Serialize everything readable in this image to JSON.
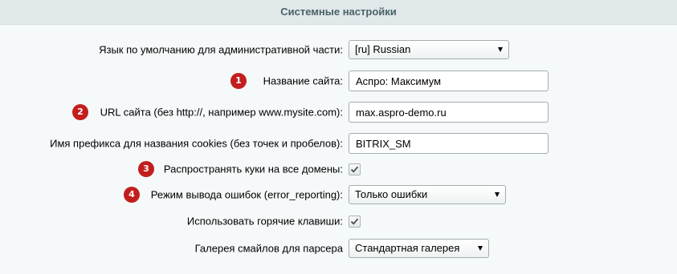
{
  "header": {
    "title": "Системные настройки"
  },
  "rows": [
    {
      "label": "Язык по умолчанию для административной части:",
      "value": "[ru] Russian"
    },
    {
      "badge": "1",
      "label": "Название сайта:",
      "value": "Аспро: Максимум"
    },
    {
      "badge": "2",
      "label": "URL сайта (без http://, например www.mysite.com):",
      "value": "max.aspro-demo.ru"
    },
    {
      "label": "Имя префикса для названия cookies (без точек и пробелов):",
      "value": "BITRIX_SM"
    },
    {
      "badge": "3",
      "label": "Распространять куки на все домены:",
      "checked": true
    },
    {
      "badge": "4",
      "label": "Режим вывода ошибок (error_reporting):",
      "value": "Только ошибки"
    },
    {
      "label": "Использовать горячие клавиши:",
      "checked": true
    },
    {
      "label": "Галерея смайлов для парсера",
      "value": "Стандартная галерея"
    }
  ],
  "colors": {
    "badge": "#c31e1e",
    "header_bg": "#e0e8ea",
    "page_bg": "#f5f9f9"
  }
}
